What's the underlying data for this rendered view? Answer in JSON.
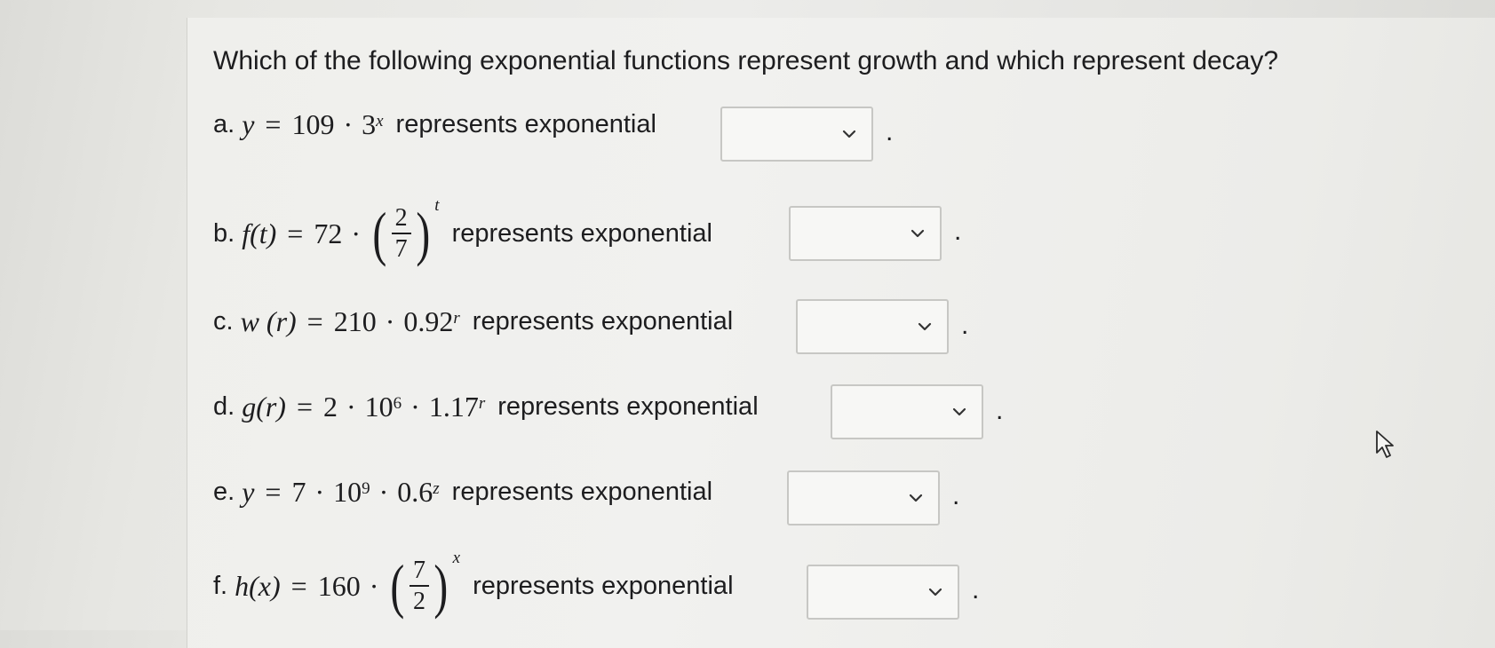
{
  "question": "Which of the following exponential functions represent growth and which represent decay?",
  "label": "represents exponential",
  "period": ".",
  "items": [
    {
      "letter": "a.",
      "pre": "y",
      "eq": "=",
      "coef": "109",
      "dot": "·",
      "base": "3",
      "exp": "x",
      "dropdown": {
        "value": ""
      }
    },
    {
      "letter": "b.",
      "pre": "f(t)",
      "eq": "=",
      "coef": "72",
      "dot": "·",
      "lp": "(",
      "num": "2",
      "den": "7",
      "rp": ")",
      "exp": "t",
      "dropdown": {
        "value": ""
      }
    },
    {
      "letter": "c.",
      "pre": "w (r)",
      "eq": "=",
      "coef": "210",
      "dot": "·",
      "base": "0.92",
      "exp": "r",
      "dropdown": {
        "value": ""
      }
    },
    {
      "letter": "d.",
      "pre": "g(r)",
      "eq": "=",
      "coef": "2",
      "dot": "·",
      "base1": "10",
      "exp1": "6",
      "dot2": "·",
      "base": "1.17",
      "exp": "r",
      "dropdown": {
        "value": ""
      }
    },
    {
      "letter": "e.",
      "pre": "y",
      "eq": "=",
      "coef": "7",
      "dot": "·",
      "base1": "10",
      "exp1": "9",
      "dot2": "·",
      "base": "0.6",
      "exp": "z",
      "dropdown": {
        "value": ""
      }
    },
    {
      "letter": "f.",
      "pre": "h(x)",
      "eq": "=",
      "coef": "160",
      "dot": "·",
      "lp": "(",
      "num": "7",
      "den": "2",
      "rp": ")",
      "exp": "x",
      "dropdown": {
        "value": ""
      }
    }
  ],
  "icons": {
    "dropdown": "chevron-down-icon",
    "cursor": "mouse-pointer-icon"
  }
}
